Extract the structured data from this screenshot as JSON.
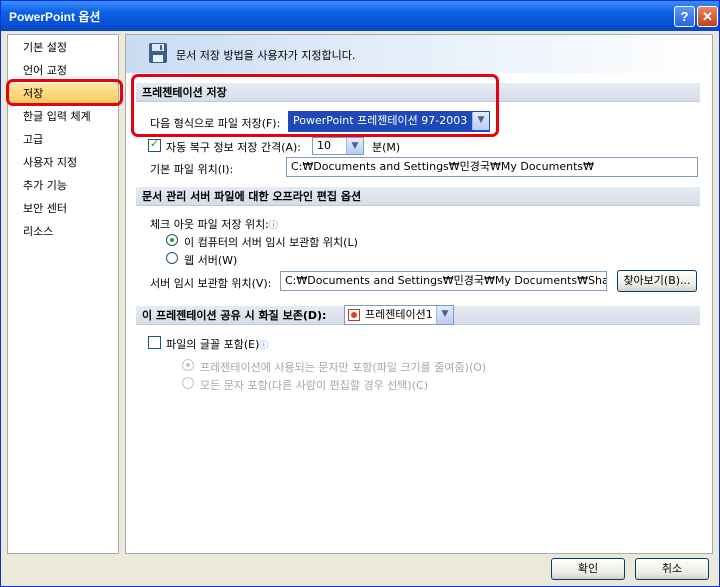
{
  "window": {
    "title": "PowerPoint 옵션",
    "help_glyph": "?",
    "close_glyph": "✕"
  },
  "nav": {
    "items": [
      {
        "label": "기본 설정"
      },
      {
        "label": "언어 교정"
      },
      {
        "label": "저장"
      },
      {
        "label": "한글 입력 체계"
      },
      {
        "label": "고급"
      },
      {
        "label": "사용자 지정"
      },
      {
        "label": "추가 기능"
      },
      {
        "label": "보안 센터"
      },
      {
        "label": "리소스"
      }
    ],
    "selected": "저장"
  },
  "banner": {
    "text": "문서 저장 방법을 사용자가 지정합니다.",
    "icon": "floppy-disk-icon"
  },
  "save_section": {
    "header": "프레젠테이션 저장",
    "format_label": "다음 형식으로 파일 저장(F):",
    "format_value": "PowerPoint 프레젠테이션 97-2003",
    "autorecover_label": "자동 복구 정보 저장 간격(A):",
    "autorecover_value": "10",
    "autorecover_unit": "분(M)",
    "default_location_label": "기본 파일 위치(I):",
    "default_location_value": "C:₩Documents and Settings₩민경국₩My Documents₩"
  },
  "offline_section": {
    "header": "문서 관리 서버 파일에 대한 오프라인 편집 옵션",
    "checkout_label": "체크 아웃 파일 저장 위치:",
    "option_local": "이 컴퓨터의 서버 임시 보관함 위치(L)",
    "option_web": "웹 서버(W)",
    "drafts_label": "서버 임시 보관함 위치(V):",
    "drafts_value": "C:₩Documents and Settings₩민경국₩My Documents₩SharePoint 임시",
    "browse_button": "찾아보기(B)..."
  },
  "fidelity_section": {
    "header": "이 프레젠테이션 공유 시 화질 보존(D):",
    "presentation_value": "프레젠테이션1",
    "embed_fonts_label": "파일의 글꼴 포함(E)",
    "embed_used_chars": "프레젠테이션에 사용되는 문자만 포함(파일 크기를 줄여줌)(O)",
    "embed_all_chars": "모든 문자 포함(다른 사람이 편집할 경우 선택)(C)"
  },
  "footer": {
    "ok_button": "확인",
    "cancel_button": "취소"
  },
  "colors": {
    "title_bar": "#0a5fe4",
    "highlight_box": "#e8000e",
    "combo_selected": "#1e49b6",
    "nav_selected": "#fbc45a"
  }
}
